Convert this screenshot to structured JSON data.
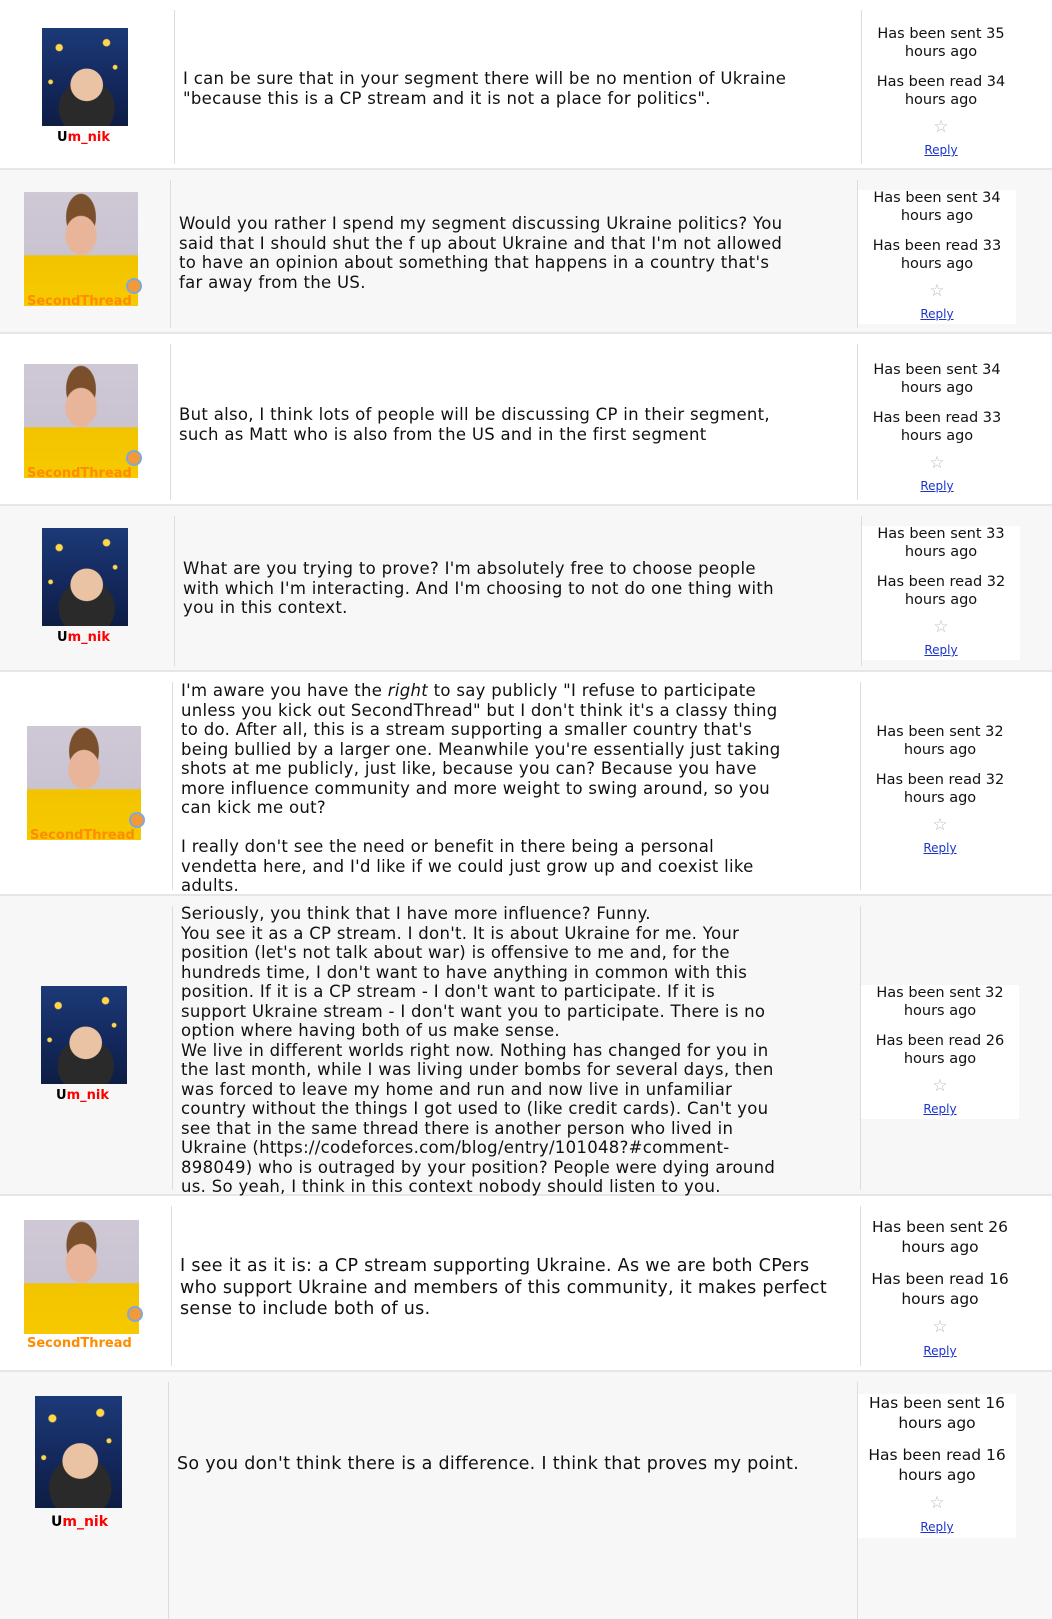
{
  "comments": [
    {
      "author": "Um_nik",
      "author_first": "U",
      "author_rest": "m_nik",
      "text": "I can be sure that in your segment there will be no mention of Ukraine\n\"because this is a CP stream and it is not a place for politics\".",
      "sent": "Has been sent 35 hours ago",
      "read": "Has been read 34 hours ago",
      "reply": "Reply"
    },
    {
      "author": "SecondThread",
      "text": "Would you rather I spend my segment discussing Ukraine politics? You\nsaid that I should shut the f up about Ukraine and that I'm not allowed\nto have an opinion about something that happens in a country that's\nfar away from the US.",
      "sent": "Has been sent 34 hours ago",
      "read": "Has been read 33 hours ago",
      "reply": "Reply"
    },
    {
      "author": "SecondThread",
      "text": "But also, I think lots of people will be discussing CP in their segment,\nsuch as Matt who is also from the US and in the first segment",
      "sent": "Has been sent 34 hours ago",
      "read": "Has been read 33 hours ago",
      "reply": "Reply"
    },
    {
      "author": "Um_nik",
      "author_first": "U",
      "author_rest": "m_nik",
      "text": "What are you trying to prove? I'm absolutely free to choose people\nwith which I'm interacting. And I'm choosing to not do one thing with\nyou in this context.",
      "sent": "Has been sent 33 hours ago",
      "read": "Has been read 32 hours ago",
      "reply": "Reply"
    },
    {
      "author": "SecondThread",
      "text_before": "I'm aware you have the ",
      "text_em": "right",
      "text_after": " to say publicly \"I refuse to participate\nunless you kick out SecondThread\" but I don't think it's a classy thing\nto do. After all, this is a stream supporting a smaller country that's\nbeing bullied by a larger one. Meanwhile you're essentially just taking\nshots at me publicly, just like, because you can? Because you have\nmore influence community and more weight to swing around, so you\ncan kick me out?\n\nI really don't see the need or benefit in there being a personal\nvendetta here, and I'd like if we could just grow up and coexist like\nadults.",
      "sent": "Has been sent 32 hours ago",
      "read": "Has been read 32 hours ago",
      "reply": "Reply"
    },
    {
      "author": "Um_nik",
      "author_first": "U",
      "author_rest": "m_nik",
      "text": "Seriously, you think that I have more influence? Funny.\nYou see it as a CP stream. I don't. It is about Ukraine for me. Your\nposition (let's not talk about war) is offensive to me and, for the\nhundreds time, I don't want to have anything in common with this\nposition. If it is a CP stream - I don't want to participate. If it is\nsupport Ukraine stream - I don't want you to participate. There is no\noption where having both of us make sense.\nWe live in different worlds right now. Nothing has changed for you in\nthe last month, while I was living under bombs for several days, then\nwas forced to leave my home and run and now live in unfamiliar\ncountry without the things I got used to (like credit cards). Can't you\nsee that in the same thread there is another person who lived in\nUkraine (https://codeforces.com/blog/entry/101048?#comment-\n898049) who is outraged by your position? People were dying around\nus. So yeah, I think in this context nobody should listen to you.",
      "sent": "Has been sent 32 hours ago",
      "read": "Has been read 26 hours ago",
      "reply": "Reply"
    },
    {
      "author": "SecondThread",
      "text": "I see it as it is: a CP stream supporting Ukraine. As we are both CPers\nwho support Ukraine and members of this community, it makes perfect\nsense to include both of us.",
      "sent": "Has been sent 26 hours ago",
      "read": "Has been read 16 hours ago",
      "reply": "Reply"
    },
    {
      "author": "Um_nik",
      "author_first": "U",
      "author_rest": "m_nik",
      "text": "So you don't think there is a difference. I think that proves my point.",
      "sent": "Has been sent 16 hours ago",
      "read": "Has been read 16 hours ago",
      "reply": "Reply"
    }
  ],
  "icons": {
    "star": "star-icon",
    "badge": "medal-badge-icon"
  },
  "colors": {
    "link": "#1a33cc",
    "um_nik_handle": "#ff0000",
    "secondthread_handle": "#ff8c00"
  }
}
